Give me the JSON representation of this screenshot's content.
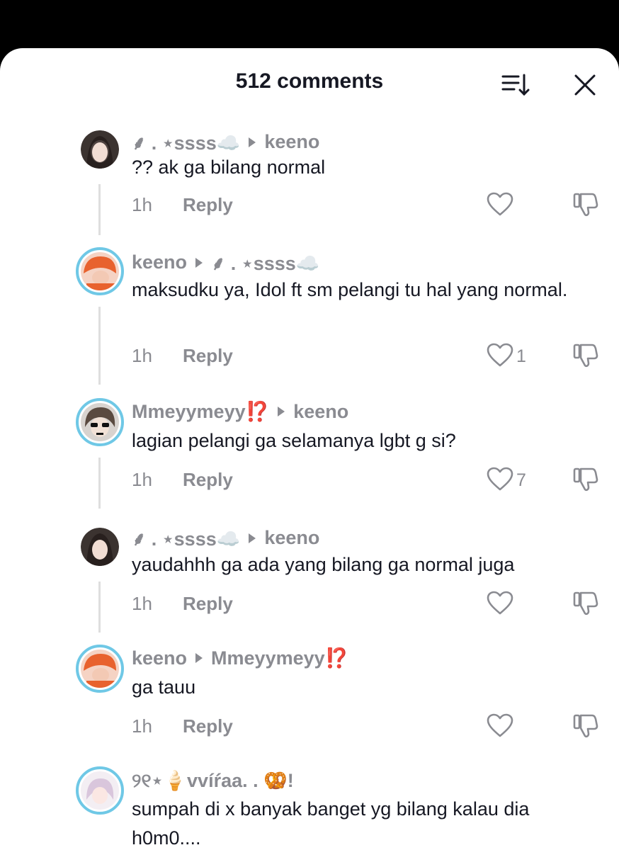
{
  "header": {
    "title": "512 comments"
  },
  "icons": {
    "sort": "sort-icon",
    "close": "close-icon",
    "heart": "heart-icon",
    "dislike": "thumbs-down-icon"
  },
  "comments": [
    {
      "author": "⸙ . ⋆ssss☁️",
      "reply_to": "keeno",
      "text": "?? ak ga bilang normal",
      "time": "1h",
      "reply_label": "Reply",
      "likes": ""
    },
    {
      "author": "keeno",
      "reply_to": "⸙ . ⋆ssss☁️",
      "text": "maksudku ya, Idol ft sm pelangi tu hal yang normal.",
      "time": "1h",
      "reply_label": "Reply",
      "likes": "1"
    },
    {
      "author": "Mmeyymeyy",
      "author_emoji": "⁉️",
      "reply_to": "keeno",
      "text": "lagian pelangi ga selamanya lgbt g si?",
      "time": "1h",
      "reply_label": "Reply",
      "likes": "7"
    },
    {
      "author": "⸙ . ⋆ssss☁️",
      "reply_to": "keeno",
      "text": "yaudahhh ga ada yang bilang ga normal juga",
      "time": "1h",
      "reply_label": "Reply",
      "likes": ""
    },
    {
      "author": "keeno",
      "reply_to": "Mmeyymeyy",
      "reply_to_emoji": "⁉️",
      "text": "ga tauu",
      "time": "1h",
      "reply_label": "Reply",
      "likes": ""
    },
    {
      "author": "୨୧⋆🍦vvíŕaa. . 🥨!",
      "text": "sumpah di x banyak banget yg bilang kalau dia h0m0...."
    }
  ]
}
